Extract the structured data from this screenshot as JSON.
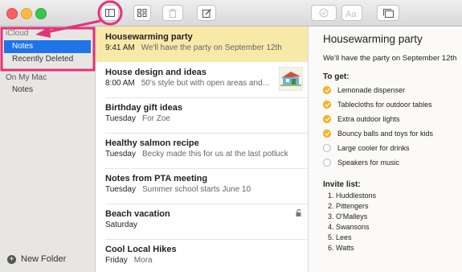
{
  "sidebar": {
    "icloud_header": "iCloud",
    "icloud_items": [
      "Notes",
      "Recently Deleted"
    ],
    "mac_header": "On My Mac",
    "mac_items": [
      "Notes"
    ],
    "new_folder_label": "New Folder"
  },
  "notes": [
    {
      "title": "Housewarming party",
      "date": "9:41 AM",
      "preview": "We'll have the party on September 12th"
    },
    {
      "title": "House design and ideas",
      "date": "8:00 AM",
      "preview": "50's style but with open areas and..."
    },
    {
      "title": "Birthday gift ideas",
      "date": "Tuesday",
      "preview": "For Zoe"
    },
    {
      "title": "Healthy salmon recipe",
      "date": "Tuesday",
      "preview": "Becky made this for us at the last potluck"
    },
    {
      "title": "Notes from PTA meeting",
      "date": "Tuesday",
      "preview": "Summer school starts June 10"
    },
    {
      "title": "Beach vacation",
      "date": "Saturday",
      "preview": ""
    },
    {
      "title": "Cool Local Hikes",
      "date": "Friday",
      "preview": "Mora"
    }
  ],
  "detail": {
    "title": "Housewarming party",
    "body": "We'll have the party on September 12th",
    "todo_heading": "To get:",
    "checklist": [
      {
        "text": "Lemonade dispenser",
        "checked": true
      },
      {
        "text": "Tablecloths for outdoor tables",
        "checked": true
      },
      {
        "text": "Extra outdoor lights",
        "checked": true
      },
      {
        "text": "Bouncy balls and toys for kids",
        "checked": true
      },
      {
        "text": "Large cooler for drinks",
        "checked": false
      },
      {
        "text": "Speakers for music",
        "checked": false
      }
    ],
    "invite_heading": "Invite list:",
    "invite_list": [
      "1. Huddlestons",
      "2. Pittengers",
      "3. O'Malleys",
      "4. Swansons",
      "5. Lees",
      "6. Watts"
    ]
  },
  "icons": {
    "toolbar": [
      "sidebar-toggle-icon",
      "gallery-view-icon",
      "trash-icon",
      "compose-icon",
      "checklist-icon",
      "format-text-icon",
      "attachments-browser-icon"
    ],
    "annotation_color": "#e2337a",
    "selection_color": "#1f74e8",
    "highlight_color": "#f8e9a9",
    "checkbox_color": "#f5b823"
  }
}
